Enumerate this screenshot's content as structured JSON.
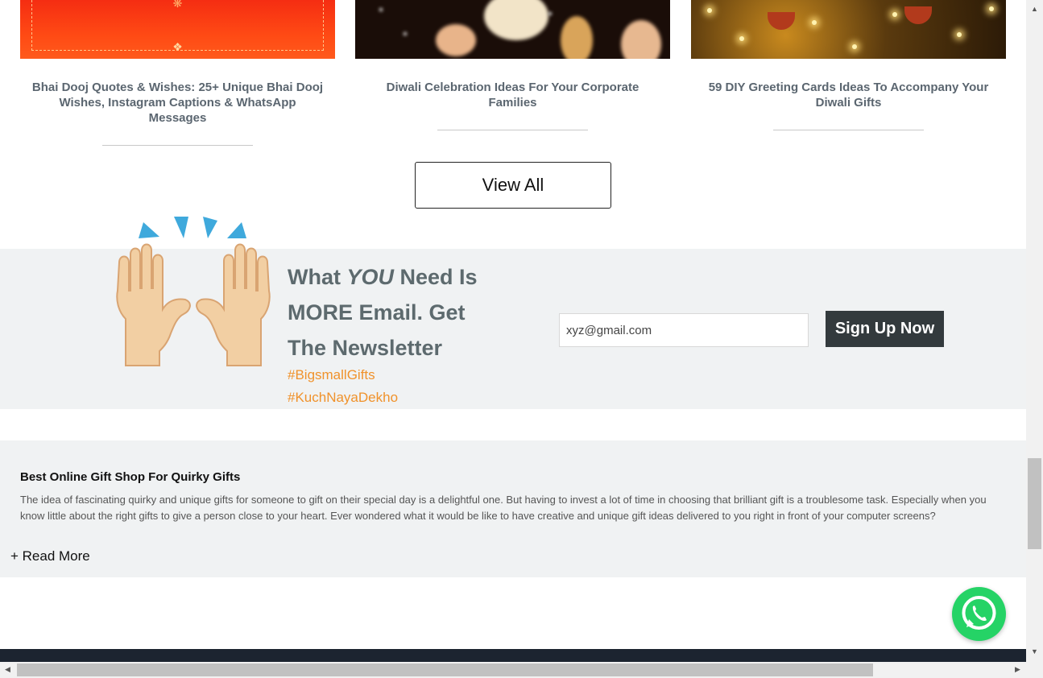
{
  "blog_cards": [
    {
      "title": "Bhai Dooj Quotes & Wishes: 25+ Unique Bhai Dooj Wishes, Instagram Captions & WhatsApp Messages"
    },
    {
      "title": "Diwali Celebration Ideas For Your Corporate Families"
    },
    {
      "title": "59 DIY Greeting Cards Ideas To Accompany Your Diwali Gifts"
    }
  ],
  "view_all_label": "View All",
  "newsletter": {
    "heading_part1": "What ",
    "heading_emphasis": "YOU",
    "heading_part2": " Need Is MORE Email. Get The Newsletter",
    "tags": [
      "#BigsmallGifts",
      "#KuchNayaDekho"
    ],
    "email_value": "xyz@gmail.com",
    "signup_label": "Sign Up Now",
    "icon": "raised-hands-icon"
  },
  "about": {
    "heading": "Best Online Gift Shop For Quirky Gifts",
    "body": "The idea of fascinating quirky and unique gifts for someone to gift on their special day is a delightful one. But having to invest a lot of time in choosing that brilliant gift is a troublesome task. Especially when you know little about the right gifts to give a person close to your heart. Ever wondered what it would be like to have creative and unique gift ideas delivered to you right in front of your computer screens?",
    "read_more_label": "+ Read More"
  },
  "colors": {
    "tag_orange": "#f0922b",
    "signup_bg": "#333a3d",
    "whatsapp_green": "#25d366",
    "section_bg": "#f0f2f3"
  }
}
